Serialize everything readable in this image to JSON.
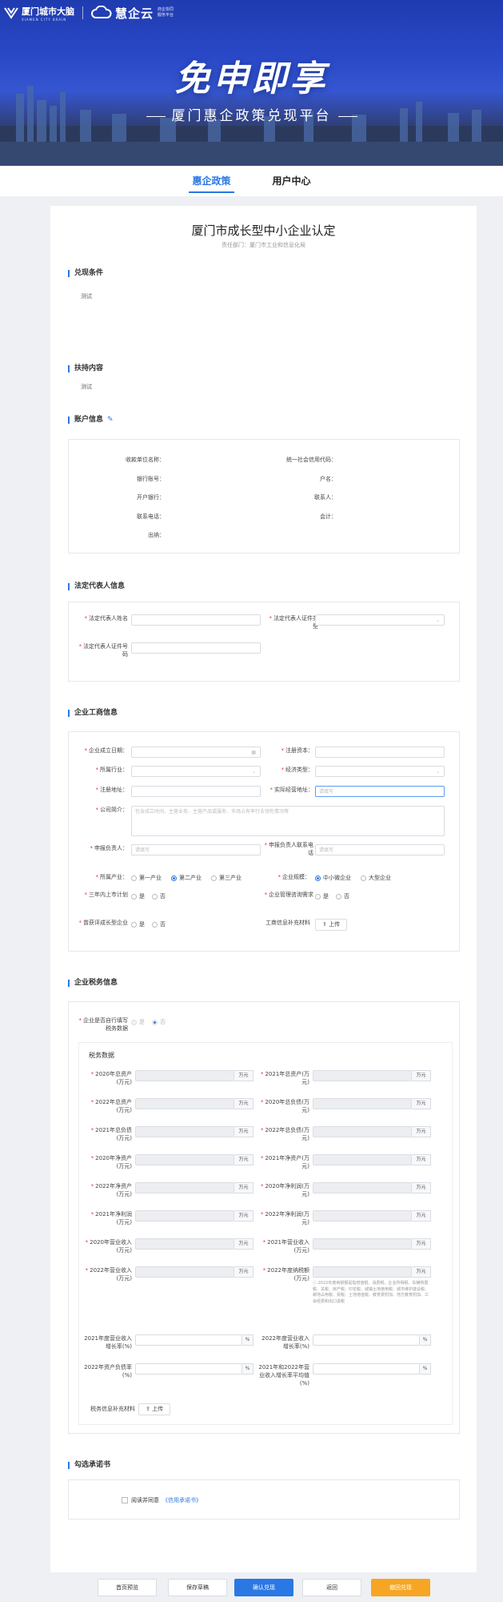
{
  "header": {
    "logo1_title": "厦门城市大脑",
    "logo1_sub": "XIAMEN CITY BRAIN",
    "logo2_title": "慧企云",
    "logo2_sub1": "商企协同",
    "logo2_sub2": "服务平台",
    "slogan": "免申即享",
    "subslogan": "厦门惠企政策兑现平台"
  },
  "tabs": [
    {
      "label": "惠企政策"
    },
    {
      "label": "用户中心"
    }
  ],
  "page": {
    "title": "厦门市成长型中小企业认定",
    "dept": "责任部门：厦门市工业和信息化局"
  },
  "sections": {
    "conditions": "兑现条件",
    "conditions_text": "测试",
    "support": "扶持内容",
    "support_text": "测试",
    "account": "账户信息",
    "legal": "法定代表人信息",
    "business": "企业工商信息",
    "tax": "企业税务信息",
    "pledge": "勾选承诺书"
  },
  "account": {
    "labels": [
      "收款单位名称：",
      "银行账号：",
      "开户银行：",
      "联系电话：",
      "出纳：",
      "统一社会信用代码：",
      "户名：",
      "联系人：",
      "会计："
    ]
  },
  "legal": {
    "name": "法定代表人姓名",
    "id_type": "法定代表人证件类型",
    "id_no": "法定代表人证件号码"
  },
  "business": {
    "found_date": "企业成立日期：",
    "reg_capital": "注册资本：",
    "industry": "所属行业：",
    "econ_type": "经济类型：",
    "reg_addr": "注册地址：",
    "op_addr": "实际经营地址：",
    "op_addr_ph": "请填写",
    "intro": "公司简介：",
    "intro_ph": "包含成立时间、主营业务、主营产品或服务、市场占有率行业领先情况等",
    "contact": "申报负责人：",
    "contact_ph": "请填写",
    "contact_phone": "申报负责人联系电话",
    "contact_phone_ph": "请填写",
    "sector": "所属产业：",
    "sectors": [
      "第一产业",
      "第二产业",
      "第三产业"
    ],
    "scale": "企业规模：",
    "scales": [
      "中小微企业",
      "大型企业"
    ],
    "above_scale": "三年内上市计划",
    "mgmt": "企业管理咨询需求",
    "awarded": "曾获评成长型企业",
    "yes": "是",
    "no": "否",
    "upload_label": "工商信息补充材料",
    "upload": "上传"
  },
  "tax": {
    "self_fill": "企业是否自行填写税务数据",
    "yes": "是",
    "no": "否",
    "panel": "税务数据",
    "rows": [
      [
        "2020年总资产(万元)",
        "万元",
        "2021年总资产(万元)",
        "万元"
      ],
      [
        "2022年总资产(万元)",
        "万元",
        "2020年总负债(万元)",
        "万元"
      ],
      [
        "2021年总负债(万元)",
        "万元",
        "2022年总负债(万元)",
        "万元"
      ],
      [
        "2020年净资产(万元)",
        "万元",
        "2021年净资产(万元)",
        "万元"
      ],
      [
        "2022年净资产(万元)",
        "万元",
        "2020年净利润(万元)",
        "万元"
      ],
      [
        "2021年净利润(万元)",
        "万元",
        "2022年净利润(万元)",
        "万元"
      ],
      [
        "2020年营业收入(万元)",
        "万元",
        "2021年营业收入(万元)",
        "万元"
      ],
      [
        "2022年营业收入(万元)",
        "万元",
        "2022年度纳税额(万元)",
        "万元"
      ]
    ],
    "tax_note": "2022年度纳税额是指增值税、消费税、企业所得税、车辆购置税、关税、房产税、印花税、城镇土地使用税、城市维护建设税、耕地占用税、契税、土地增值税、教育费附加、地方教育附加、工会经费和出口退税",
    "rate_rows": [
      [
        "2021年度营业收入增长率(%)",
        "%",
        "2022年度营业收入增长率(%)",
        "%"
      ],
      [
        "2022年资产负债率(%)",
        "%",
        "2021年和2022年营业收入增长率平均值(%)",
        "%"
      ]
    ],
    "upload_label": "税务信息补充材料",
    "upload": "上传"
  },
  "pledge": {
    "read": "阅读并同意",
    "link": "《信用承诺书》"
  },
  "footer": {
    "buttons": [
      "首页预览",
      "保存草稿",
      "确认兑现",
      "返回",
      "撤回兑现"
    ]
  }
}
